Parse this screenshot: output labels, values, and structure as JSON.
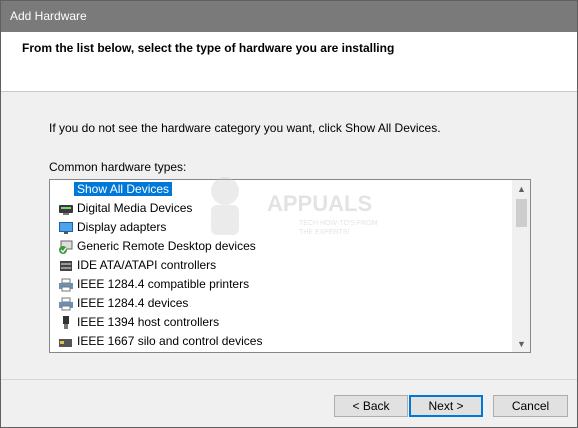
{
  "window": {
    "title": "Add Hardware"
  },
  "header": {
    "heading": "From the list below, select the type of hardware you are installing"
  },
  "main": {
    "instruction": "If you do not see the hardware category you want, click Show All Devices.",
    "list_label": "Common hardware types:",
    "items": [
      {
        "label": "Show All Devices",
        "icon": "none",
        "selected": true
      },
      {
        "label": "Digital Media Devices",
        "icon": "media-device-icon"
      },
      {
        "label": "Display adapters",
        "icon": "display-adapter-icon"
      },
      {
        "label": "Generic Remote Desktop devices",
        "icon": "remote-desktop-icon"
      },
      {
        "label": "IDE ATA/ATAPI controllers",
        "icon": "ide-controller-icon"
      },
      {
        "label": "IEEE 1284.4 compatible printers",
        "icon": "printer-icon"
      },
      {
        "label": "IEEE 1284.4 devices",
        "icon": "printer-icon"
      },
      {
        "label": "IEEE 1394 host controllers",
        "icon": "firewire-icon"
      },
      {
        "label": "IEEE 1667 silo and control devices",
        "icon": "silo-device-icon"
      }
    ]
  },
  "watermark": {
    "brand": "APPUALS",
    "tagline_1": "TECH HOW-TO'S FROM",
    "tagline_2": "THE EXPERTS!"
  },
  "buttons": {
    "back": "< Back",
    "next": "Next >",
    "cancel": "Cancel"
  },
  "colors": {
    "selection": "#0078d7",
    "titlebar": "#7a7a7a"
  }
}
